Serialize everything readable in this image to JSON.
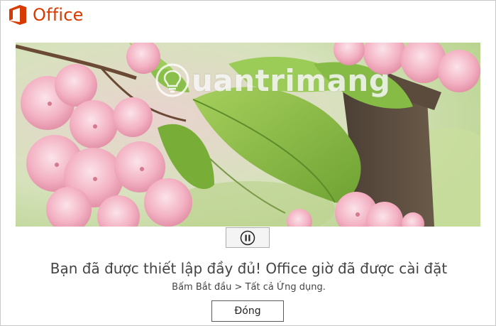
{
  "app": {
    "name": "Office",
    "brand_color": "#d83b01",
    "logo_icon": "office-logo-icon"
  },
  "media": {
    "description_icon": "cherry-blossom-photo",
    "control_icon": "pause-icon"
  },
  "watermark": {
    "text": "uantrimang",
    "icon": "lightbulb-icon"
  },
  "message": {
    "headline": "Bạn đã được thiết lập đầy đủ! Office giờ đã được cài đặt",
    "subtext": "Bấm Bắt đầu > Tất cả Ứng dụng."
  },
  "buttons": {
    "close_label": "Đóng"
  },
  "colors": {
    "text": "#444444",
    "leaf": "#7fb43c",
    "blossom": "#f0a4b8"
  }
}
